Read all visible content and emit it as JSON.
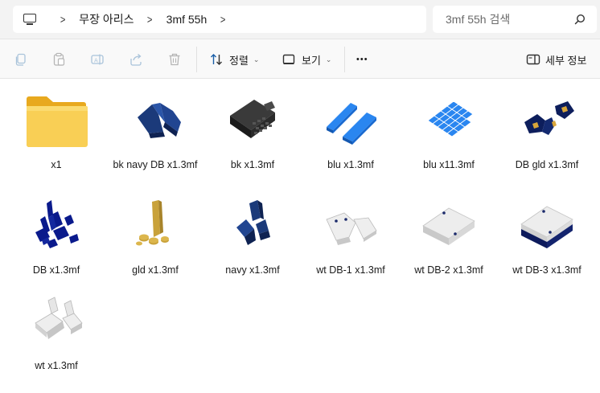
{
  "address": {
    "root_icon": "pc-icon",
    "breadcrumb": [
      "무장 아리스",
      "3mf 55h"
    ]
  },
  "search": {
    "placeholder": "3mf 55h 검색"
  },
  "toolbar": {
    "sort_label": "정렬",
    "view_label": "보기",
    "more_label": "•••",
    "details_label": "세부 정보"
  },
  "files": [
    {
      "name": "x1",
      "kind": "folder"
    },
    {
      "name": "bk navy DB x1.3mf",
      "kind": "model"
    },
    {
      "name": "bk x1.3mf",
      "kind": "model"
    },
    {
      "name": "blu x1.3mf",
      "kind": "model"
    },
    {
      "name": "blu x11.3mf",
      "kind": "model"
    },
    {
      "name": "DB gld x1.3mf",
      "kind": "model"
    },
    {
      "name": "DB x1.3mf",
      "kind": "model"
    },
    {
      "name": "gld x1.3mf",
      "kind": "model"
    },
    {
      "name": "navy x1.3mf",
      "kind": "model"
    },
    {
      "name": "wt DB-1 x1.3mf",
      "kind": "model"
    },
    {
      "name": "wt DB-2 x1.3mf",
      "kind": "model"
    },
    {
      "name": "wt DB-3 x1.3mf",
      "kind": "model"
    },
    {
      "name": "wt x1.3mf",
      "kind": "model"
    }
  ],
  "colors": {
    "navy": "#14306b",
    "black": "#2a2a2a",
    "blue": "#1f78e0",
    "gold": "#c9a23a",
    "white": "#ececec",
    "folder": "#f5c542",
    "darkblue": "#0a1a8c"
  }
}
